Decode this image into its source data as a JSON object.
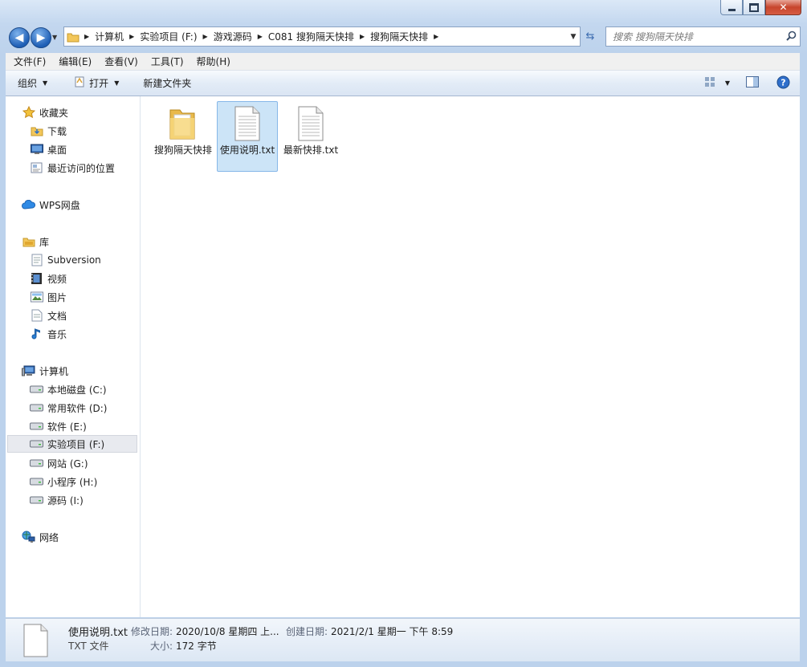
{
  "window": {
    "caption": {
      "minimize": "minimize-icon",
      "maximize": "maximize-icon",
      "close": "close-icon"
    }
  },
  "nav": {
    "back": "◀",
    "forward": "▶",
    "breadcrumbs": [
      "计算机",
      "实验项目 (F:)",
      "游戏源码",
      "C081 搜狗隔天快排",
      "搜狗隔天快排"
    ],
    "search_placeholder": "搜索 搜狗隔天快排"
  },
  "menubar": [
    "文件(F)",
    "编辑(E)",
    "查看(V)",
    "工具(T)",
    "帮助(H)"
  ],
  "toolbar": {
    "organize": "组织",
    "open": "打开",
    "new_folder": "新建文件夹"
  },
  "sidebar": {
    "favorites": {
      "label": "收藏夹",
      "items": [
        "下载",
        "桌面",
        "最近访问的位置"
      ]
    },
    "wps": {
      "label": "WPS网盘"
    },
    "libraries": {
      "label": "库",
      "items": [
        "Subversion",
        "视频",
        "图片",
        "文档",
        "音乐"
      ]
    },
    "computer": {
      "label": "计算机",
      "items": [
        "本地磁盘 (C:)",
        "常用软件 (D:)",
        "软件 (E:)",
        "实验项目 (F:)",
        "网站 (G:)",
        "小程序 (H:)",
        "源码 (I:)"
      ]
    },
    "network": {
      "label": "网络"
    }
  },
  "files": [
    {
      "name": "搜狗隔天快排",
      "type": "folder"
    },
    {
      "name": "使用说明.txt",
      "type": "txt",
      "selected": true
    },
    {
      "name": "最新快排.txt",
      "type": "txt"
    }
  ],
  "details": {
    "filename": "使用说明.txt",
    "filetype": "TXT 文件",
    "modified_label": "修改日期:",
    "modified_value": "2020/10/8 星期四 上...",
    "created_label": "创建日期:",
    "created_value": "2021/2/1 星期一 下午 8:59",
    "size_label": "大小:",
    "size_value": "172 字节"
  },
  "colors": {
    "accent": "#3c7fb1",
    "selection": "#cce4f7",
    "folder": "#f3c75a"
  }
}
